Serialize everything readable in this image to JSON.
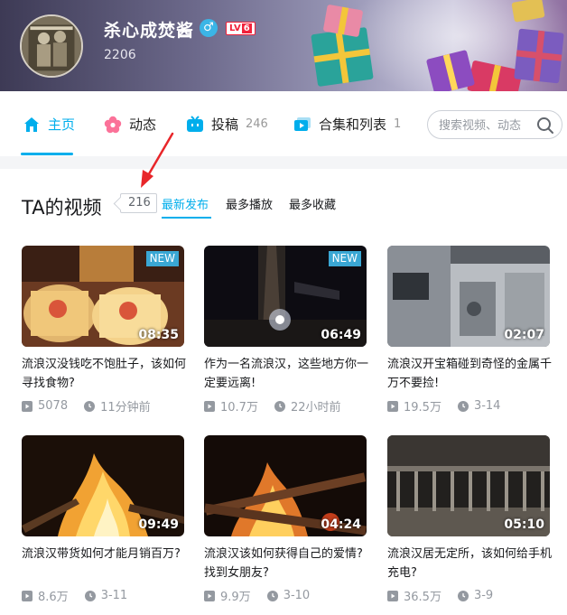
{
  "user": {
    "name": "杀心成焚酱",
    "uid": "2206",
    "level_prefix": "LV",
    "level": "6",
    "gender_symbol": "♂"
  },
  "nav": {
    "items": [
      {
        "label": "主页",
        "icon": "home-icon",
        "count": ""
      },
      {
        "label": "动态",
        "icon": "flower-icon",
        "count": ""
      },
      {
        "label": "投稿",
        "icon": "tv-icon",
        "count": "246"
      },
      {
        "label": "合集和列表",
        "icon": "playlist-icon",
        "count": "1"
      }
    ],
    "search_placeholder": "搜索视频、动态"
  },
  "section": {
    "title": "TA的视频",
    "count": "216",
    "sort_tabs": [
      "最新发布",
      "最多播放",
      "最多收藏"
    ]
  },
  "videos": [
    {
      "title": "流浪汉没钱吃不饱肚子，该如何寻找食物?",
      "duration": "08:35",
      "views": "5078",
      "time": "11分钟前",
      "is_new": true,
      "new_label": "NEW"
    },
    {
      "title": "作为一名流浪汉，这些地方你一定要远离!",
      "duration": "06:49",
      "views": "10.7万",
      "time": "22小时前",
      "is_new": true,
      "new_label": "NEW"
    },
    {
      "title": "流浪汉开宝箱碰到奇怪的金属千万不要捡!",
      "duration": "02:07",
      "views": "19.5万",
      "time": "3-14",
      "is_new": false,
      "new_label": ""
    },
    {
      "title": "流浪汉带货如何才能月销百万?",
      "duration": "09:49",
      "views": "8.6万",
      "time": "3-11",
      "is_new": false,
      "new_label": ""
    },
    {
      "title": "流浪汉该如何获得自己的爱情? 找到女朋友?",
      "duration": "04:24",
      "views": "9.9万",
      "time": "3-10",
      "is_new": false,
      "new_label": ""
    },
    {
      "title": "流浪汉居无定所，该如何给手机充电?",
      "duration": "05:10",
      "views": "36.5万",
      "time": "3-9",
      "is_new": false,
      "new_label": ""
    }
  ],
  "colors": {
    "accent": "#00aeec",
    "level_red": "#f2213a",
    "arrow_red": "#e8262a",
    "new_badge": "#3aa7d4"
  }
}
